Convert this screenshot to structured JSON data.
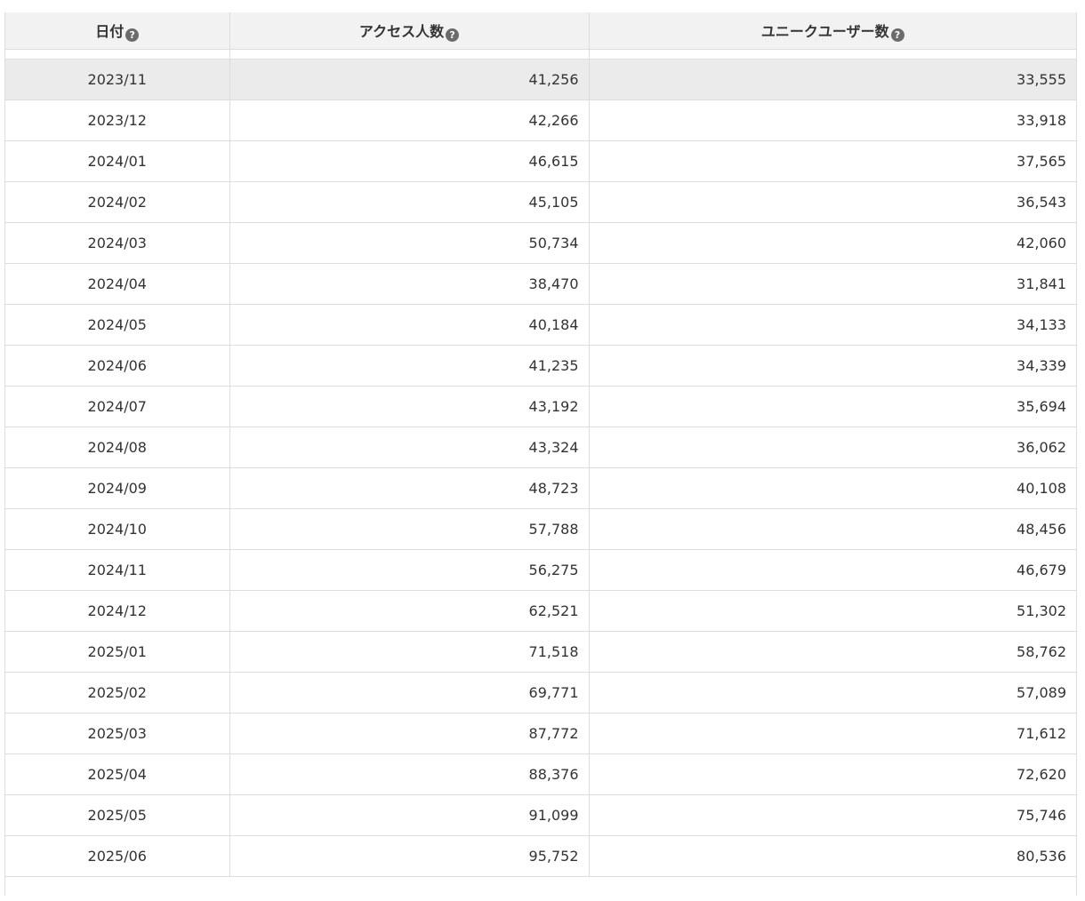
{
  "table": {
    "columns": [
      {
        "key": "date",
        "label": "日付"
      },
      {
        "key": "access",
        "label": "アクセス人数"
      },
      {
        "key": "unique",
        "label": "ユニークユーザー数"
      }
    ],
    "help_icon_glyph": "?",
    "highlight_color": "#ebebeb",
    "rows": [
      {
        "date": "2023/11",
        "access": "41,256",
        "unique": "33,555"
      },
      {
        "date": "2023/12",
        "access": "42,266",
        "unique": "33,918"
      },
      {
        "date": "2024/01",
        "access": "46,615",
        "unique": "37,565"
      },
      {
        "date": "2024/02",
        "access": "45,105",
        "unique": "36,543"
      },
      {
        "date": "2024/03",
        "access": "50,734",
        "unique": "42,060"
      },
      {
        "date": "2024/04",
        "access": "38,470",
        "unique": "31,841"
      },
      {
        "date": "2024/05",
        "access": "40,184",
        "unique": "34,133"
      },
      {
        "date": "2024/06",
        "access": "41,235",
        "unique": "34,339"
      },
      {
        "date": "2024/07",
        "access": "43,192",
        "unique": "35,694"
      },
      {
        "date": "2024/08",
        "access": "43,324",
        "unique": "36,062"
      },
      {
        "date": "2024/09",
        "access": "48,723",
        "unique": "40,108"
      },
      {
        "date": "2024/10",
        "access": "57,788",
        "unique": "48,456"
      },
      {
        "date": "2024/11",
        "access": "56,275",
        "unique": "46,679"
      },
      {
        "date": "2024/12",
        "access": "62,521",
        "unique": "51,302"
      },
      {
        "date": "2025/01",
        "access": "71,518",
        "unique": "58,762"
      },
      {
        "date": "2025/02",
        "access": "69,771",
        "unique": "57,089"
      },
      {
        "date": "2025/03",
        "access": "87,772",
        "unique": "71,612"
      },
      {
        "date": "2025/04",
        "access": "88,376",
        "unique": "72,620"
      },
      {
        "date": "2025/05",
        "access": "91,099",
        "unique": "75,746"
      },
      {
        "date": "2025/06",
        "access": "95,752",
        "unique": "80,536"
      }
    ]
  }
}
